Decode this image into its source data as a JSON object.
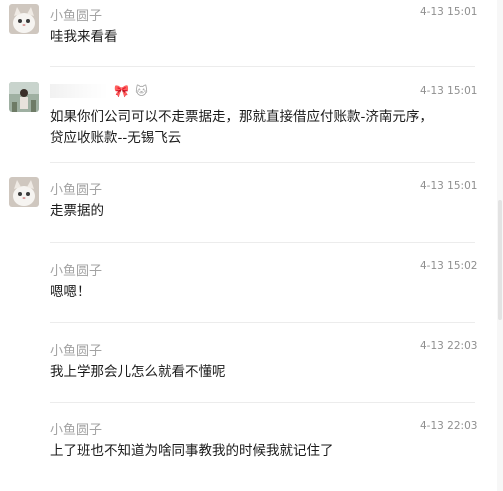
{
  "messages": [
    {
      "sender": "小鱼圆子",
      "time": "4-13 15:01",
      "lines": [
        "哇我来看看"
      ],
      "avatar": "cat-avatar"
    },
    {
      "sender": "",
      "sender_emoji": [
        "🎀",
        "🐱"
      ],
      "time": "4-13 15:01",
      "lines": [
        "如果你们公司可以不走票据走，那就直接借应付账款-济南元序，",
        "贷应收账款--无锡飞云"
      ],
      "avatar": "person-avatar"
    },
    {
      "sender": "小鱼圆子",
      "time": "4-13 15:01",
      "lines": [
        "走票据的"
      ],
      "avatar": "cat-avatar"
    },
    {
      "sender": "小鱼圆子",
      "time": "4-13 15:02",
      "lines": [
        "嗯嗯！"
      ]
    },
    {
      "sender": "小鱼圆子",
      "time": "4-13 22:03",
      "lines": [
        "我上学那会儿怎么就看不懂呢"
      ]
    },
    {
      "sender": "小鱼圆子",
      "time": "4-13 22:03",
      "lines": [
        "上了班也不知道为啥同事教我的时候我就记住了"
      ]
    }
  ],
  "colors": {
    "name": "#a3a3a3",
    "time": "#8f8f8f",
    "text": "#1a1a1a",
    "divider": "#ececec"
  }
}
